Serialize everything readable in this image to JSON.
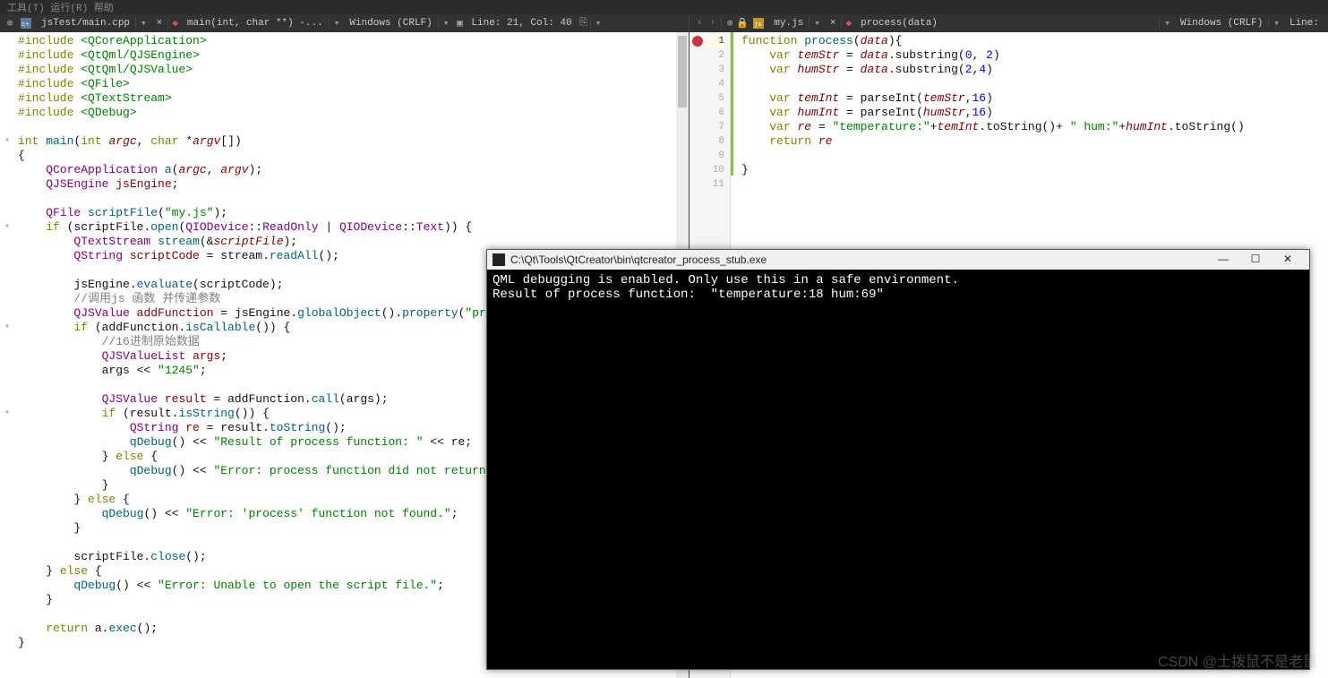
{
  "menu": "  工具(T)  运行(R)  帮助",
  "left_editor": {
    "filename": "jsTest/main.cpp",
    "breadcrumb": "main(int, char **) -...",
    "encoding": "Windows (CRLF)",
    "position": "Line: 21, Col: 40",
    "code_html": "<span class='kw'>#include</span> <span class='inc'>&lt;QCoreApplication&gt;</span>\n<span class='kw'>#include</span> <span class='inc'>&lt;QtQml/QJSEngine&gt;</span>\n<span class='kw'>#include</span> <span class='inc'>&lt;QtQml/QJSValue&gt;</span>\n<span class='kw'>#include</span> <span class='inc'>&lt;QFile&gt;</span>\n<span class='kw'>#include</span> <span class='inc'>&lt;QTextStream&gt;</span>\n<span class='kw'>#include</span> <span class='inc'>&lt;QDebug&gt;</span>\n\n<span class='kw'>int</span> <span class='fn'>main</span>(<span class='kw'>int</span> <span class='param'>argc</span>, <span class='kw'>char</span> *<span class='param'>argv</span>[])\n{\n    <span class='type'>QCoreApplication</span> <span class='fn'>a</span>(<span class='param'>argc</span>, <span class='param'>argv</span>);\n    <span class='type'>QJSEngine</span> <span class='member'>jsEngine</span>;\n\n    <span class='type'>QFile</span> <span class='fn'>scriptFile</span>(<span class='str'>\"my.js\"</span>);\n    <span class='kw'>if</span> (scriptFile.<span class='call'>open</span>(<span class='type'>QIODevice</span>::<span class='type'>ReadOnly</span> | <span class='type'>QIODevice</span>::<span class='type'>Text</span>)) {\n        <span class='type'>QTextStream</span> <span class='fn'>stream</span>(&amp;<span class='param'>scriptFile</span>);\n        <span class='type'>QString</span> <span class='member'>scriptCode</span> = stream.<span class='call'>readAll</span>();\n\n        jsEngine.<span class='call'>evaluate</span>(scriptCode);\n        <span class='cmt'>//调用js 函数 并传递参数</span>\n        <span class='type'>QJSValue</span> <span class='member'>addFunction</span> = jsEngine.<span class='call'>globalObject</span>().<span class='call'>property</span>(<span class='str'>\"process\"</span>);\n        <span class='kw'>if</span> (addFunction.<span class='call'>isCallable</span>()) {\n            <span class='cmt'>//16进制原始数据</span>\n            <span class='type'>QJSValueList</span> <span class='member'>args</span>;\n            args &lt;&lt; <span class='str'>\"1245\"</span>;\n\n            <span class='type'>QJSValue</span> <span class='member'>result</span> = addFunction.<span class='call'>call</span>(args);\n            <span class='kw'>if</span> (result.<span class='call'>isString</span>()) {\n                <span class='type'>QString</span> <span class='member'>re</span> = result.<span class='call'>toString</span>();\n                <span class='call'>qDebug</span>() &lt;&lt; <span class='str'>\"Result of process function: \"</span> &lt;&lt; re;\n            } <span class='kw'>else</span> {\n                <span class='call'>qDebug</span>() &lt;&lt; <span class='str'>\"Error: process function did not return a valid</span>\n            }\n        } <span class='kw'>else</span> {\n            <span class='call'>qDebug</span>() &lt;&lt; <span class='str'>\"Error: 'process' function not found.\"</span>;\n        }\n\n        scriptFile.<span class='call'>close</span>();\n    } <span class='kw'>else</span> {\n        <span class='call'>qDebug</span>() &lt;&lt; <span class='str'>\"Error: Unable to open the script file.\"</span>;\n    }\n\n    <span class='kw'>return</span> a.<span class='call'>exec</span>();\n}"
  },
  "right_editor": {
    "filename": "my.js",
    "breadcrumb": "process(data)",
    "encoding": "Windows (CRLF)",
    "position": "Line:",
    "line_numbers": [
      "1",
      "2",
      "3",
      "4",
      "5",
      "6",
      "7",
      "8",
      "9",
      "10",
      "11"
    ],
    "code_html": "<span class='kw'>function</span> <span class='fn'>process</span>(<span class='param'>data</span>){\n    <span class='kw'>var</span> <span class='var'>temStr</span> = <span class='var'>data</span>.substring(<span class='num'>0</span>, <span class='num'>2</span>)\n    <span class='kw'>var</span> <span class='var'>humStr</span> = <span class='var'>data</span>.substring(<span class='num'>2</span>,<span class='num'>4</span>)\n\n    <span class='kw'>var</span> <span class='var'>temInt</span> = parseInt(<span class='var'>temStr</span>,<span class='num'>16</span>)\n    <span class='kw'>var</span> <span class='var'>humInt</span> = parseInt(<span class='var'>humStr</span>,<span class='num'>16</span>)\n    <span class='kw'>var</span> <span class='var'>re</span> = <span class='str'>\"temperature:\"</span>+<span class='var'>temInt</span>.toString()+ <span class='str'>\" hum:\"</span>+<span class='var'>humInt</span>.toString()\n    <span class='kw'>return</span> <span class='var'>re</span>\n\n}\n"
  },
  "terminal": {
    "title": "C:\\Qt\\Tools\\QtCreator\\bin\\qtcreator_process_stub.exe",
    "output": "QML debugging is enabled. Only use this in a safe environment.\nResult of process function:  \"temperature:18 hum:69\""
  },
  "watermark": "CSDN @土拨鼠不是老鼠",
  "icons": {
    "pin": "⊕",
    "lock": "🔒",
    "dropdown": "▾",
    "close": "×",
    "diamond": "◆",
    "nav_left": "‹",
    "nav_right": "›",
    "minimize": "—",
    "maximize": "☐",
    "win_close": "✕",
    "fold_down": "▾",
    "split": "⎘"
  }
}
